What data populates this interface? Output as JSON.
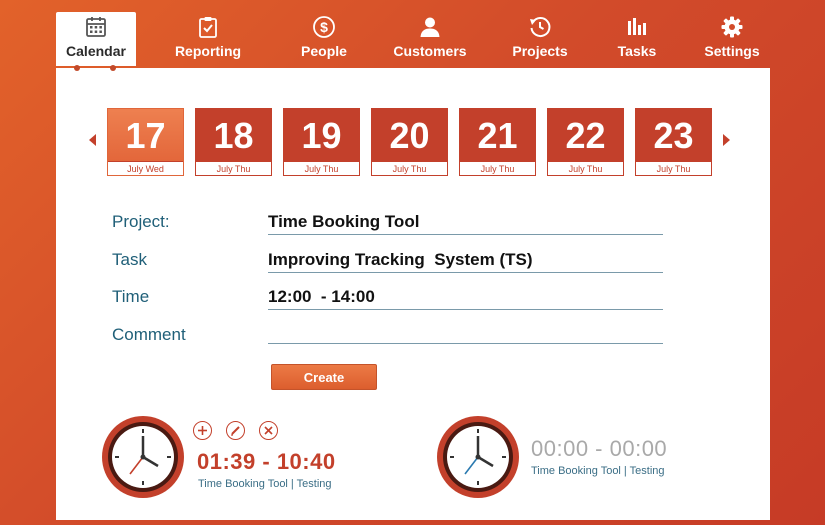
{
  "nav": {
    "items": [
      {
        "label": "Calendar",
        "icon": "calendar-icon",
        "active": true
      },
      {
        "label": "Reporting",
        "icon": "clipboard-check-icon",
        "active": false
      },
      {
        "label": "People",
        "icon": "dollar-circle-icon",
        "active": false
      },
      {
        "label": "Customers",
        "icon": "user-icon",
        "active": false
      },
      {
        "label": "Projects",
        "icon": "history-icon",
        "active": false
      },
      {
        "label": "Tasks",
        "icon": "bar-chart-icon",
        "active": false
      },
      {
        "label": "Settings",
        "icon": "gear-icon",
        "active": false
      }
    ]
  },
  "dates": [
    {
      "day": "17",
      "label": "July Wed",
      "selected": true
    },
    {
      "day": "18",
      "label": "July Thu",
      "selected": false
    },
    {
      "day": "19",
      "label": "July Thu",
      "selected": false
    },
    {
      "day": "20",
      "label": "July Thu",
      "selected": false
    },
    {
      "day": "21",
      "label": "July Thu",
      "selected": false
    },
    {
      "day": "22",
      "label": "July Thu",
      "selected": false
    },
    {
      "day": "23",
      "label": "July Thu",
      "selected": false
    }
  ],
  "form": {
    "project_label": "Project:",
    "project_value": "Time Booking Tool",
    "task_label": "Task",
    "task_value": "Improving Tracking  System (TS)",
    "time_label": "Time",
    "time_value": "12:00  - 14:00",
    "comment_label": "Comment",
    "comment_value": "",
    "create_label": "Create"
  },
  "bookings": [
    {
      "time": "01:39 - 10:40",
      "subtitle": "Time Booking Tool | Testing",
      "actions": [
        "plus-icon",
        "pencil-icon",
        "close-icon"
      ]
    },
    {
      "time": "00:00  - 00:00",
      "subtitle": "Time Booking Tool | Testing"
    }
  ],
  "colors": {
    "accent": "#c3402b",
    "accent_light": "#e86a3a",
    "label_blue": "#1f5f78",
    "background": "#d24b2a"
  }
}
